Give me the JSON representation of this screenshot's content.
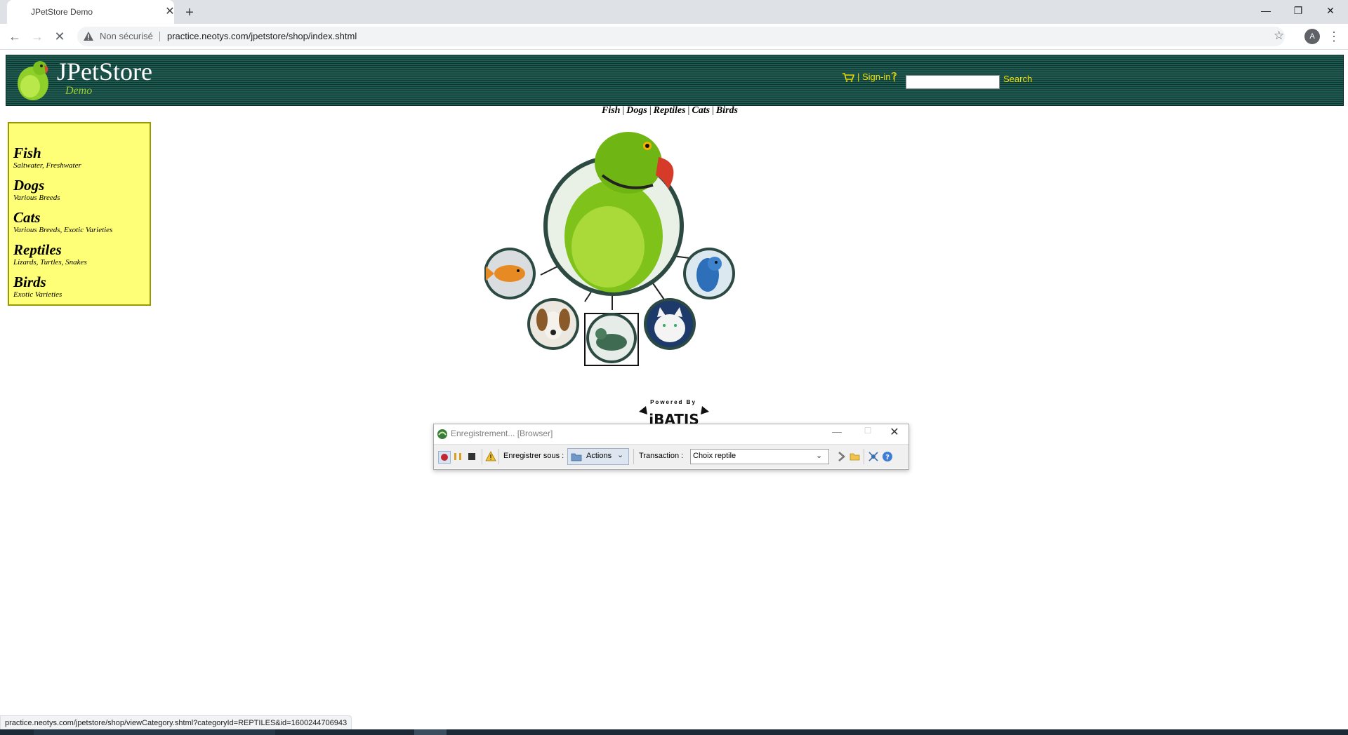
{
  "browser": {
    "tab_title": "JPetStore Demo",
    "not_secure_label": "Non sécurisé",
    "url": "practice.neotys.com/jpetstore/shop/index.shtml",
    "profile_initial": "A"
  },
  "header": {
    "logo_title": "JPetStore",
    "logo_subtitle": "Demo",
    "signin_label": "Sign-in",
    "help_label": "?",
    "search_value": "",
    "search_label": "Search"
  },
  "quick_links": [
    "Fish",
    "Dogs",
    "Reptiles",
    "Cats",
    "Birds"
  ],
  "sidebar": {
    "categories": [
      {
        "name": "Fish",
        "sub": "Saltwater, Freshwater"
      },
      {
        "name": "Dogs",
        "sub": "Various Breeds"
      },
      {
        "name": "Cats",
        "sub": "Various Breeds, Exotic Varieties"
      },
      {
        "name": "Reptiles",
        "sub": "Lizards, Turtles, Snakes"
      },
      {
        "name": "Birds",
        "sub": "Exotic Varieties"
      }
    ]
  },
  "powered_by": {
    "text": "Powered By",
    "logo_text": "iBATIS"
  },
  "recorder": {
    "title": "Enregistrement... [Browser]",
    "save_as_label": "Enregistrer sous :",
    "actions_label": "Actions",
    "transaction_label": "Transaction :",
    "transaction_value": "Choix reptile"
  },
  "status_bar": {
    "text": "practice.neotys.com/jpetstore/shop/viewCategory.shtml?categoryId=REPTILES&id=1600244706943"
  },
  "colors": {
    "header_green": "#1e5a4f",
    "sidebar_yellow": "#ffff77",
    "link_yellow": "#f0e000"
  }
}
